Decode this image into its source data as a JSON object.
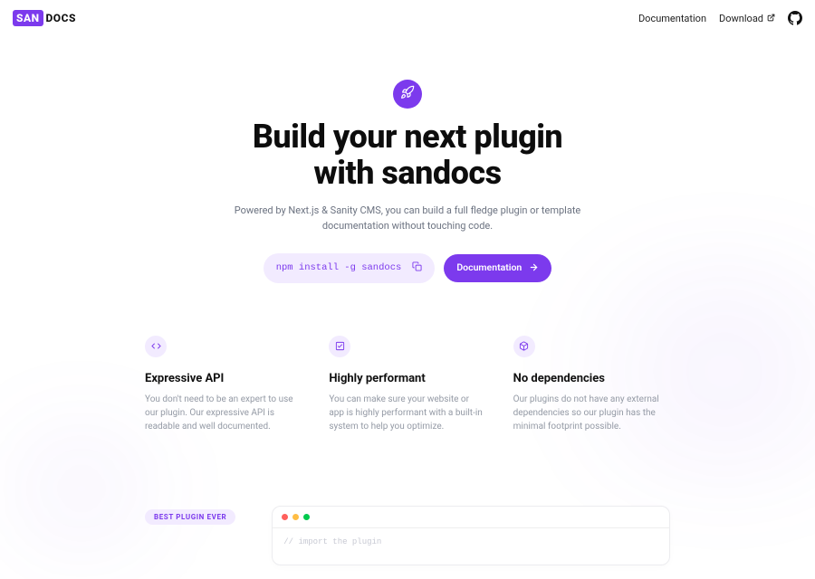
{
  "brand": {
    "chip": "SAN",
    "rest": "DOCS"
  },
  "nav": {
    "doc": "Documentation",
    "download": "Download"
  },
  "hero": {
    "title_line1": "Build your next plugin",
    "title_line2": "with sandocs",
    "subtitle": "Powered by Next.js & Sanity CMS, you can build a full fledge plugin or template documentation without touching code.",
    "install_cmd": "npm install -g sandocs",
    "cta_label": "Documentation"
  },
  "features": [
    {
      "title": "Expressive API",
      "body": "You don't need to be an expert to use our plugin. Our expressive API is readable and well documented."
    },
    {
      "title": "Highly performant",
      "body": "You can make sure your website or app is highly performant with a built-in system to help you optimize."
    },
    {
      "title": "No dependencies",
      "body": "Our plugins do not have any external dependencies so our plugin has the minimal footprint possible."
    }
  ],
  "lower": {
    "badge": "BEST PLUGIN EVER",
    "code_comment": "// import the plugin"
  }
}
